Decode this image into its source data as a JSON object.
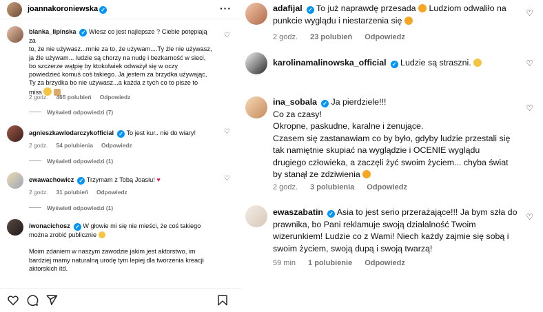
{
  "left": {
    "header": {
      "username": "joannakoroniewska"
    },
    "comments": [
      {
        "username": "blanka_lipinska",
        "lines": [
          "Wiesz co jest najlepsze ? Ciebie potępiają za",
          "to, że nie używasz...mnie za to, że używam....Ty źle nie używasz,",
          "ja źle używam... ludzie są chorzy na nudę i bezkarność w sieci,",
          "bo szczerze wątpię by ktokolwiek odważył się w oczy",
          "powiedzieć komuś coś takiego. Ja jestem za brzydka używając,",
          "Ty za brzydka bo nie używasz...a każda z tych co to pisze to",
          "miss"
        ],
        "time": "2 godz.",
        "likes": "465 polubień",
        "reply": "Odpowiedz",
        "view_replies": "Wyświetl odpowiedzi (7)"
      },
      {
        "username": "agnieszkawlodarczykofficial",
        "text": "To jest kur.. nie do wiary!",
        "time": "2 godz.",
        "likes": "54 polubienia",
        "reply": "Odpowiedz",
        "view_replies": "Wyświetl odpowiedzi (1)"
      },
      {
        "username": "ewawachowicz",
        "text": "Trzymam z Tobą Joasiu!",
        "time": "2 godz.",
        "likes": "31 polubień",
        "reply": "Odpowiedz",
        "view_replies": "Wyświetl odpowiedzi (1)"
      },
      {
        "username": "iwonacichosz",
        "lines": [
          "W głowie mi się nie mieści, że coś takiego",
          "można zrobić publicznie",
          "",
          "Moim zdaniem w naszym zawodzie jakim jest aktorstwo, im",
          "bardziej mamy naturalną urodę tym lepiej dla tworzenia kreacji",
          "aktorskich itd."
        ]
      }
    ]
  },
  "right": {
    "comments": [
      {
        "username": "adafijal",
        "lines": [
          "To już naprawdę przesada",
          "punkcie wyglądu i niestarzenia się"
        ],
        "line1_tail": "Ludziom odwaliło na",
        "time": "2 godz.",
        "likes": "23 polubień",
        "reply": "Odpowiedz"
      },
      {
        "username": "karolinamalinowska_official",
        "text": "Ludzie są straszni."
      },
      {
        "username": "ina_sobala",
        "text": "Ja pierdziele!!!",
        "lines": [
          "Co za czasy!",
          "Okropne, paskudne, karalne i żenujące.",
          "Czasem się zastanawiam co by było, gdyby ludzie przestali się",
          "tak namiętnie skupiać na wyglądzie i OCENIE wyglądu",
          "drugiego człowieka, a zaczęli żyć swoim życiem... chyba świat",
          "by stanął ze zdziwienia"
        ],
        "time": "2 godz.",
        "likes": "3 polubienia",
        "reply": "Odpowiedz"
      },
      {
        "username": "ewaszabatin",
        "lines": [
          "Asia to jest serio przerażające!!! Ja bym szła do",
          "prawnika, bo Pani reklamuje swoją działalność Twoim",
          "wizerunkiem! Ludzie co z Wami! Niech każdy zajmie się sobą i",
          "swoim życiem, swoją dupą i swoją twarzą!"
        ],
        "time": "59 min",
        "likes": "1 polubienie",
        "reply": "Odpowiedz"
      }
    ]
  },
  "colors": {
    "verified": "#0095f6",
    "meta": "#737373",
    "heart_red": "#e0245e"
  }
}
